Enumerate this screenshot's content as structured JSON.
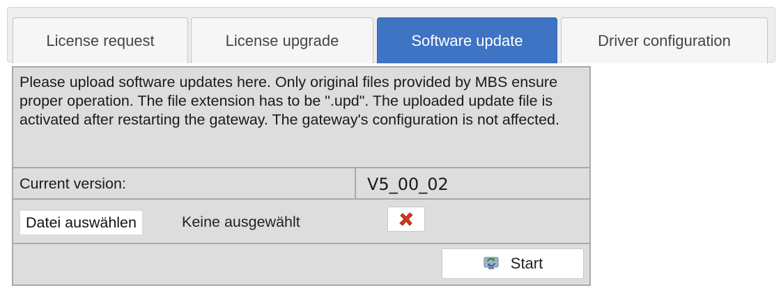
{
  "tabs": [
    {
      "label": "License request",
      "active": false
    },
    {
      "label": "License upgrade",
      "active": false
    },
    {
      "label": "Software update",
      "active": true
    },
    {
      "label": "Driver configuration",
      "active": false
    }
  ],
  "panel": {
    "description": "Please upload software updates here. Only original files provided by MBS ensure proper operation. The file extension has to be \".upd\". The uploaded update file is activated after restarting the gateway. The gateway's configuration is not affected.",
    "current_version_label": "Current version:",
    "current_version_value": "V5_00_02",
    "file_button_label": "Datei auswählen",
    "file_status": "Keine ausgewählt",
    "clear_icon": "red-x-icon",
    "start_icon": "refresh-icon",
    "start_label": "Start"
  },
  "colors": {
    "active_tab": "#3f73c3",
    "panel_background": "#dddddd",
    "clear_icon": "#d63a20"
  }
}
